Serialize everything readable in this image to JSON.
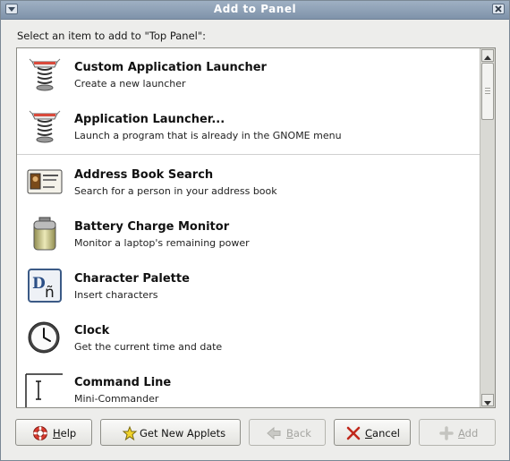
{
  "window": {
    "title": "Add to Panel"
  },
  "prompt": "Select an item to add to \"Top Panel\":",
  "items": [
    {
      "name": "Custom Application Launcher",
      "desc": "Create a new launcher",
      "icon": "launcher-spring-icon"
    },
    {
      "name": "Application Launcher...",
      "desc": "Launch a program that is already in the GNOME menu",
      "icon": "launcher-spring-icon"
    },
    {
      "name": "Address Book Search",
      "desc": "Search for a person in your address book",
      "icon": "address-card-icon"
    },
    {
      "name": "Battery Charge Monitor",
      "desc": "Monitor a laptop's remaining power",
      "icon": "battery-icon"
    },
    {
      "name": "Character Palette",
      "desc": "Insert characters",
      "icon": "character-palette-icon"
    },
    {
      "name": "Clock",
      "desc": "Get the current time and date",
      "icon": "clock-icon"
    },
    {
      "name": "Command Line",
      "desc": "Mini-Commander",
      "icon": "command-line-icon"
    }
  ],
  "buttons": {
    "help": {
      "pre": "",
      "mnemonic": "H",
      "post": "elp"
    },
    "get_applets": {
      "label": "Get New Applets"
    },
    "back": {
      "pre": "",
      "mnemonic": "B",
      "post": "ack"
    },
    "cancel": {
      "pre": "",
      "mnemonic": "C",
      "post": "ancel"
    },
    "add": {
      "pre": "",
      "mnemonic": "A",
      "post": "dd"
    }
  },
  "colors": {
    "titlebar": "#8a9db3",
    "disabled_text": "#a4a4a0"
  }
}
